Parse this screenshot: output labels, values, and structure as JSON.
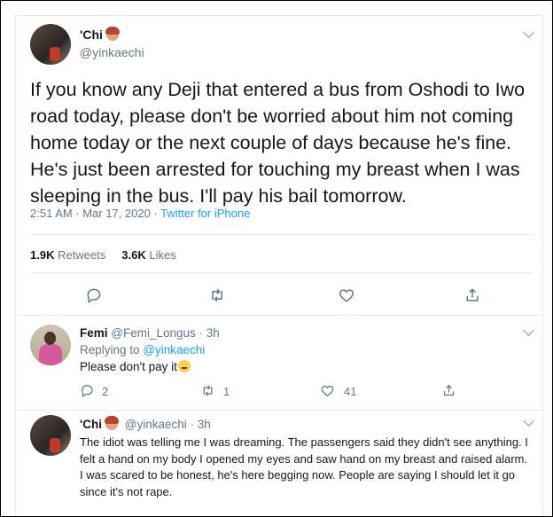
{
  "main_tweet": {
    "display_name": "'Chi",
    "handle": "@yinkaechi",
    "text": "If you know any Deji that entered a bus from Oshodi to Iwo road today, please don't be worried about him not coming home today or the next couple of days because he's fine. He's just been arrested for touching my breast when I was sleeping in the bus. I'll pay his bail tomorrow.",
    "time": "2:51 AM · Mar 17, 2020 · ",
    "source": "Twitter for iPhone",
    "retweets_count": "1.9K",
    "retweets_label": "Retweets",
    "likes_count": "3.6K",
    "likes_label": "Likes"
  },
  "reply_1": {
    "display_name": "Femi",
    "handle_time": "@Femi_Longus · 3h",
    "replying_label": "Replying to ",
    "replying_handle": "@yinkaechi",
    "text": "Please don't pay it",
    "reply_count": "2",
    "retweet_count": "1",
    "like_count": "41"
  },
  "reply_2": {
    "display_name": "'Chi",
    "handle_time": "@yinkaechi · 3h",
    "text": "The idiot was telling me I was dreaming. The passengers said they didn't see anything. I felt a hand on my body I opened my eyes and saw hand on my breast and raised alarm. I was scared to be honest, he's here begging now. People are saying I should let it go since it's not rape."
  },
  "colors": {
    "accent": "#1da1f2",
    "muted": "#657786",
    "text": "#14171a",
    "divider": "#e6ecf0"
  },
  "icons": [
    "chevron-down-icon",
    "reply-icon",
    "retweet-icon",
    "like-icon",
    "share-icon",
    "woman-emoji-icon",
    "confused-face-emoji-icon"
  ]
}
